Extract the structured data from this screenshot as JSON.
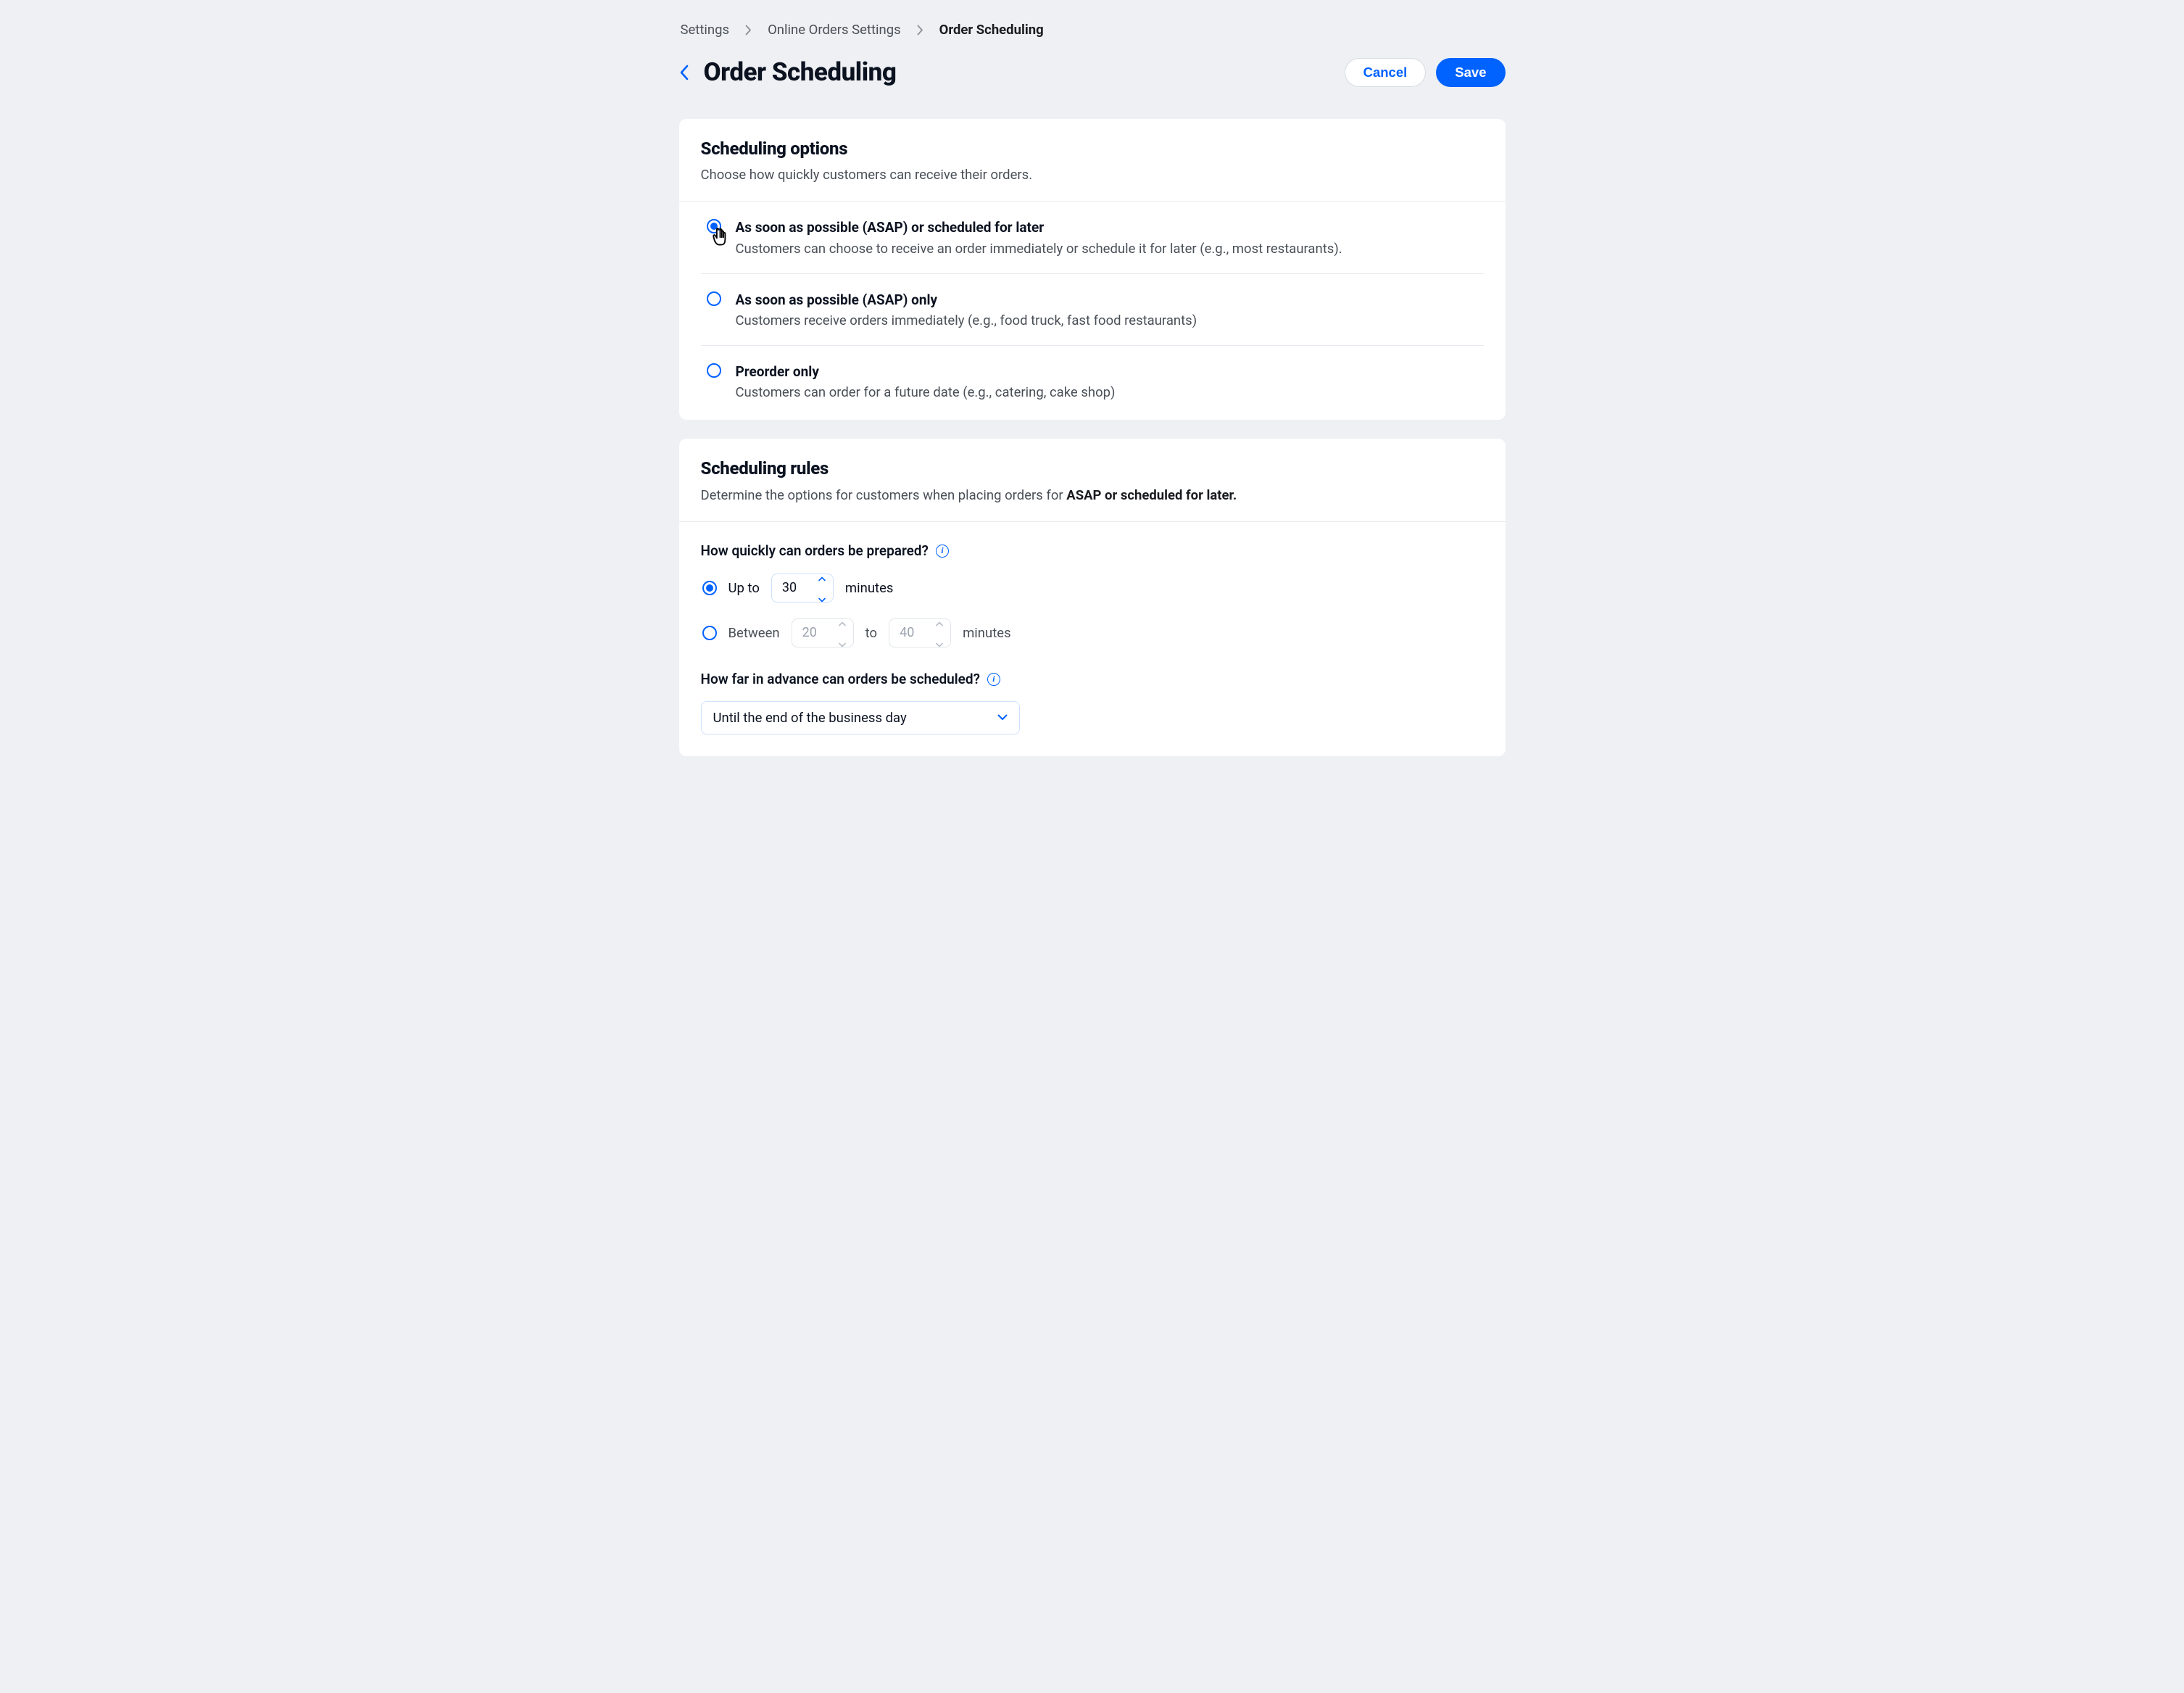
{
  "breadcrumb": {
    "items": [
      {
        "label": "Settings"
      },
      {
        "label": "Online Orders Settings"
      },
      {
        "label": "Order Scheduling"
      }
    ]
  },
  "header": {
    "title": "Order Scheduling",
    "cancel": "Cancel",
    "save": "Save"
  },
  "options_card": {
    "title": "Scheduling options",
    "subtitle": "Choose how quickly customers can receive their orders.",
    "rows": [
      {
        "title": "As soon as possible (ASAP) or scheduled for later",
        "desc": "Customers can choose to receive an order immediately or schedule it for later (e.g., most restaurants).",
        "selected": true
      },
      {
        "title": "As soon as possible (ASAP)  only",
        "desc": "Customers receive orders immediately (e.g., food truck, fast food restaurants)",
        "selected": false
      },
      {
        "title": "Preorder only",
        "desc": "Customers can order for a future date (e.g., catering, cake shop)",
        "selected": false
      }
    ]
  },
  "rules_card": {
    "title": "Scheduling rules",
    "subtitle_prefix": "Determine the options for customers when placing orders for ",
    "subtitle_bold": "ASAP or scheduled for later.",
    "prep_question": "How quickly can orders be prepared?",
    "prep_options": {
      "upto_label": "Up to",
      "upto_value": "30",
      "upto_unit": "minutes",
      "between_label": "Between",
      "between_low": "20",
      "between_to": "to",
      "between_high": "40",
      "between_unit": "minutes"
    },
    "advance_question": "How far in advance can orders be scheduled?",
    "advance_value": "Until the end of the business day"
  }
}
